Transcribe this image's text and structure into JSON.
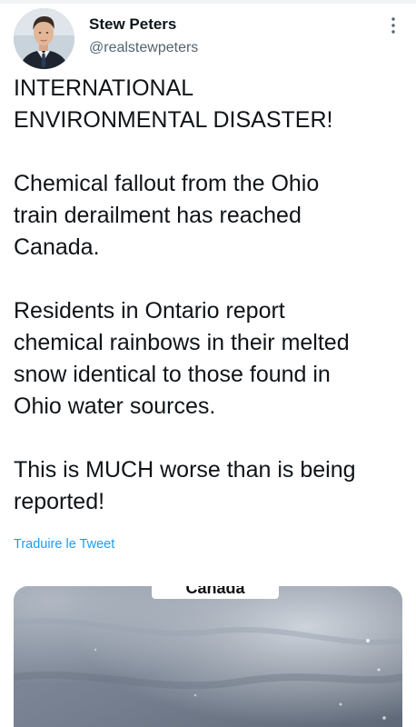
{
  "author": {
    "display_name": "Stew Peters",
    "handle": "@realstewpeters"
  },
  "tweet": {
    "text": "INTERNATIONAL\nENVIRONMENTAL DISASTER!\n\nChemical fallout from the Ohio\ntrain derailment has reached\nCanada.\n\nResidents in Ontario report\nchemical rainbows in their melted\nsnow identical to those found in\nOhio water sources.\n\nThis is MUCH worse than is being\nreported!",
    "translate_label": "Traduire le Tweet"
  },
  "media": {
    "overlay_caption": "Canada"
  },
  "icons": {
    "more": "more-vertical-icon"
  },
  "colors": {
    "text": "#0f1419",
    "secondary": "#536471",
    "link": "#1d9bf0"
  }
}
